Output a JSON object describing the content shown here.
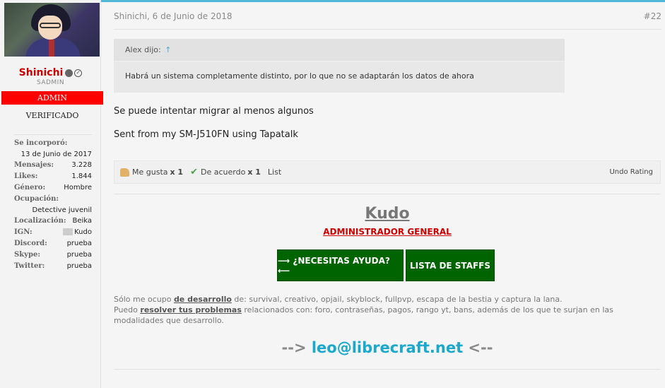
{
  "user": {
    "name": "Shinichi",
    "title": "SADMIN",
    "banner_admin": "ADMIN",
    "banner_verified": "VERIFICADO",
    "info": [
      {
        "label": "Se incorporó:",
        "value": "13 de Junio de 2017",
        "stacked": true
      },
      {
        "label": "Mensajes:",
        "value": "3.228"
      },
      {
        "label": "Likes:",
        "value": "1.844"
      },
      {
        "label": "Género:",
        "value": "Hombre"
      },
      {
        "label": "Ocupación:",
        "value": "Detective juvenil",
        "stacked": true
      },
      {
        "label": "Localización:",
        "value": "Beika"
      },
      {
        "label": "IGN:",
        "value": "Kudo"
      },
      {
        "label": "Discord:",
        "value": "prueba"
      },
      {
        "label": "Skype:",
        "value": "prueba"
      },
      {
        "label": "Twitter:",
        "value": "prueba"
      }
    ]
  },
  "post": {
    "meta": "Shinichi, 6 de Junio de 2018",
    "number": "#22",
    "quote": {
      "author": "Alex dijo:",
      "arrow": "↑",
      "text": "Habrá un sistema completamente distinto, por lo que no se adaptarán los datos de ahora"
    },
    "message": [
      "Se puede intentar migrar al menos algunos",
      "Sent from my SM-J510FN using Tapatalk"
    ],
    "likes": {
      "like_label": "Me gusta",
      "like_count": "x 1",
      "agree_label": "De acuerdo",
      "agree_count": "x 1",
      "list_label": "List",
      "undo_label": "Undo Rating"
    }
  },
  "signature": {
    "name": "Kudo",
    "role": "ADMINISTRADOR GENERAL",
    "help_button": "⟶ ¿NECESITAS AYUDA? ⟵",
    "staff_button": "LISTA DE STAFFS",
    "line1_pre": "Sólo me ocupo ",
    "line1_link": "de desarrollo",
    "line1_post": " de: survival, creativo, opjail, skyblock, fullpvp, escapa de la bestia y captura la lana.",
    "line2_pre": "Puedo ",
    "line2_link": "resolver tus problemas",
    "line2_post": " relacionados con: foro, contraseñas, pagos, rango yt, bans, además de los que te surjan en las modalidades que desarrollo.",
    "email_left": "--> ",
    "email": "leo@librecraft.net",
    "email_right": " <--"
  }
}
